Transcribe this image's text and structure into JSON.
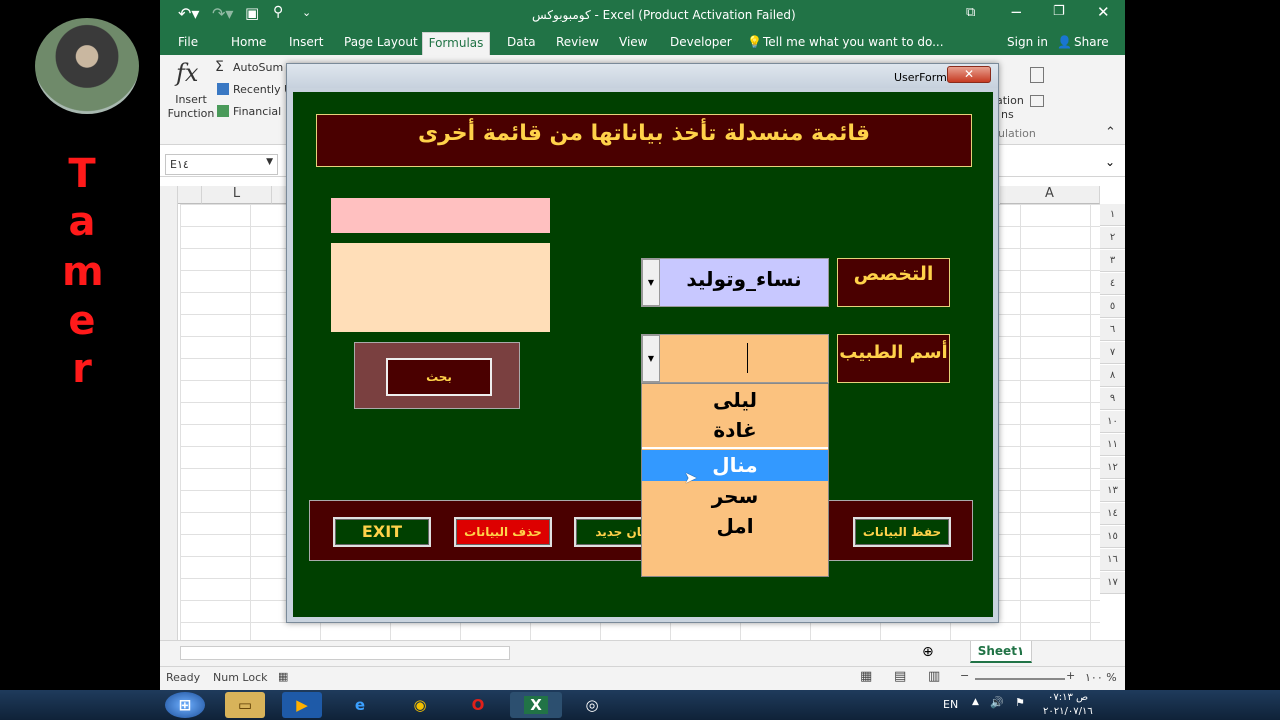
{
  "presenter": {
    "letters": [
      "T",
      "a",
      "m",
      "e",
      "r"
    ]
  },
  "titlebar": {
    "title": "كومبوبوكس - Excel (Product Activation Failed)"
  },
  "ribbon_tabs": [
    "File",
    "Home",
    "Insert",
    "Page Layout",
    "Formulas",
    "Data",
    "Review",
    "View",
    "Developer"
  ],
  "tell_me": "Tell me what you want to do...",
  "signin": "Sign in",
  "share": "Share",
  "ribbon": {
    "insert_function": "Insert Function",
    "autosum": "AutoSum",
    "recently": "Recently U",
    "financial": "Financial",
    "calc_options": "ation",
    "calc_options2": "ns",
    "calculation": "ulation"
  },
  "namebox": "E١٤",
  "columns": {
    "left": "L",
    "right": "A"
  },
  "rows": [
    "١",
    "٢",
    "٣",
    "٤",
    "٥",
    "٦",
    "٧",
    "٨",
    "٩",
    "١٠",
    "١١",
    "١٢",
    "١٣",
    "١٤",
    "١٥",
    "١٦",
    "١٧"
  ],
  "sheet_tab": "Sheet١",
  "status": {
    "ready": "Ready",
    "numlock": "Num Lock",
    "zoom": "١٠٠ %"
  },
  "userform": {
    "title": "UserForm١",
    "heading": "قائمة منسدلة تأخذ بياناتها من قائمة أخرى",
    "specialty_label": "التخصص",
    "specialty_value": "نساء_وتوليد",
    "doctor_label": "أسم الطبيب",
    "search_button": "بحث",
    "dropdown_items": [
      "ليلى",
      "غادة",
      "منال",
      "سحر",
      "امل"
    ],
    "selected_index": 2,
    "exit_button": "EXIT",
    "delete_button": "حذف البيانات",
    "new_button": "بيان جديد",
    "save_button": "حفظ البيانات"
  },
  "taskbar": {
    "lang": "EN",
    "time": "ص ٠٧:١٣",
    "date": "٢٠٢١/٠٧/١٦"
  },
  "colors": {
    "excel_green": "#217346",
    "form_bg": "#004000",
    "maroon": "#4a0000",
    "gold_text": "#ffd24a",
    "dropdown_bg": "#fbc27f",
    "selected_bg": "#3399ff"
  }
}
